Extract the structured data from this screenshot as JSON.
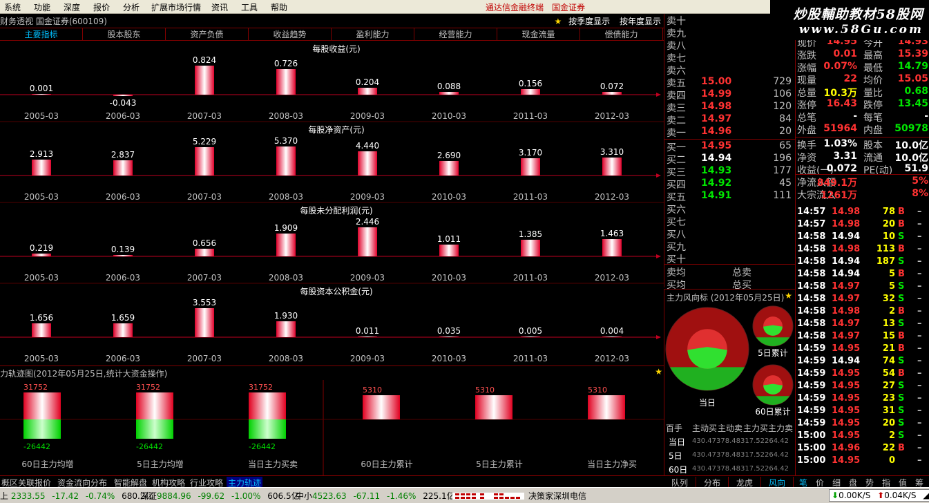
{
  "menu": {
    "items": [
      "系统",
      "功能",
      "深度",
      "报价",
      "分析",
      "扩展市场行情",
      "资讯",
      "工具",
      "帮助"
    ],
    "right_links": [
      "通达信金融终端",
      "国金证券"
    ]
  },
  "watermark": {
    "line1": "炒股輔助教材58股网",
    "line2": "www.58Gu.com"
  },
  "finance": {
    "title": "财务透视  国金证券(600109)",
    "buttons": [
      "按季度显示",
      "按年度显示"
    ],
    "tabs": [
      "主要指标",
      "股本股东",
      "资产负债",
      "收益趋势",
      "盈利能力",
      "经营能力",
      "现金流量",
      "偿债能力"
    ],
    "active_tab": 0,
    "periods": [
      "2005-03",
      "2006-03",
      "2007-03",
      "2008-03",
      "2009-03",
      "2010-03",
      "2011-03",
      "2012-03"
    ],
    "panels": [
      {
        "title": "每股收益(元)",
        "values": [
          0.001,
          -0.043,
          0.824,
          0.726,
          0.204,
          0.088,
          0.156,
          0.072
        ],
        "labels": [
          "0.001",
          "-0.043",
          "0.824",
          "0.726",
          "0.204",
          "0.088",
          "0.156",
          "0.072"
        ]
      },
      {
        "title": "每股净资产(元)",
        "values": [
          2.913,
          2.837,
          5.229,
          5.37,
          4.44,
          2.69,
          3.17,
          3.31
        ],
        "labels": [
          "2.913",
          "2.837",
          "5.229",
          "5.370",
          "4.440",
          "2.690",
          "3.170",
          "3.310"
        ]
      },
      {
        "title": "每股未分配利润(元)",
        "values": [
          0.219,
          0.139,
          0.656,
          1.909,
          2.446,
          1.011,
          1.385,
          1.463
        ],
        "labels": [
          "0.219",
          "0.139",
          "0.656",
          "1.909",
          "2.446",
          "1.011",
          "1.385",
          "1.463"
        ]
      },
      {
        "title": "每股资本公积金(元)",
        "values": [
          1.656,
          1.659,
          3.553,
          1.93,
          0.011,
          0.035,
          0.005,
          0.004
        ],
        "labels": [
          "1.656",
          "1.659",
          "3.553",
          "1.930",
          "0.011",
          "0.035",
          "0.005",
          "0.004"
        ]
      }
    ]
  },
  "main_force": {
    "title": "力轨迹图(2012年05月25日,统计大资金操作)",
    "bars": [
      {
        "label": "60日主力均增",
        "top": "31752",
        "bottom": "-26442",
        "split": true
      },
      {
        "label": "5日主力均增",
        "top": "31752",
        "bottom": "-26442",
        "split": true
      },
      {
        "label": "当日主力买卖",
        "top": "31752",
        "bottom": "-26442",
        "split": true
      },
      {
        "label": "60日主力累计",
        "top": "5310",
        "bottom": "",
        "split": false
      },
      {
        "label": "5日主力累计",
        "top": "5310",
        "bottom": "",
        "split": false
      },
      {
        "label": "当日主力净买",
        "top": "5310",
        "bottom": "",
        "split": false
      }
    ]
  },
  "order_book": {
    "sells": [
      {
        "label": "卖十",
        "price": "",
        "vol": ""
      },
      {
        "label": "卖九",
        "price": "",
        "vol": ""
      },
      {
        "label": "卖八",
        "price": "",
        "vol": ""
      },
      {
        "label": "卖七",
        "price": "",
        "vol": ""
      },
      {
        "label": "卖六",
        "price": "",
        "vol": ""
      },
      {
        "label": "卖五",
        "price": "15.00",
        "vol": "729",
        "color": "red"
      },
      {
        "label": "卖四",
        "price": "14.99",
        "vol": "106",
        "color": "red"
      },
      {
        "label": "卖三",
        "price": "14.98",
        "vol": "120",
        "color": "red"
      },
      {
        "label": "卖二",
        "price": "14.97",
        "vol": "84",
        "color": "red"
      },
      {
        "label": "卖一",
        "price": "14.96",
        "vol": "20",
        "color": "red"
      }
    ],
    "buys": [
      {
        "label": "买一",
        "price": "14.95",
        "vol": "65",
        "color": "red"
      },
      {
        "label": "买二",
        "price": "14.94",
        "vol": "196",
        "color": "wht"
      },
      {
        "label": "买三",
        "price": "14.93",
        "vol": "177",
        "color": "grn"
      },
      {
        "label": "买四",
        "price": "14.92",
        "vol": "45",
        "color": "grn"
      },
      {
        "label": "买五",
        "price": "14.91",
        "vol": "111",
        "color": "grn"
      },
      {
        "label": "买六",
        "price": "",
        "vol": ""
      },
      {
        "label": "买七",
        "price": "",
        "vol": ""
      },
      {
        "label": "买八",
        "price": "",
        "vol": ""
      },
      {
        "label": "买九",
        "price": "",
        "vol": ""
      },
      {
        "label": "买十",
        "price": "",
        "vol": ""
      }
    ],
    "avg_sell_label": "卖均",
    "avg_buy_label": "买均",
    "total_sell_label": "总卖",
    "total_buy_label": "总买"
  },
  "quote": [
    {
      "l1": "现价",
      "v1": "14.95",
      "c1": "red",
      "l2": "今开",
      "v2": "14.93",
      "c2": "red"
    },
    {
      "l1": "涨跌",
      "v1": "0.01",
      "c1": "red",
      "l2": "最高",
      "v2": "15.39",
      "c2": "red"
    },
    {
      "l1": "涨幅",
      "v1": "0.07%",
      "c1": "red",
      "l2": "最低",
      "v2": "14.79",
      "c2": "grn"
    },
    {
      "l1": "现量",
      "v1": "22",
      "c1": "red",
      "l2": "均价",
      "v2": "15.05",
      "c2": "red"
    },
    {
      "l1": "总量",
      "v1": "10.3万",
      "c1": "yel",
      "l2": "量比",
      "v2": "0.68",
      "c2": "grn"
    },
    {
      "l1": "涨停",
      "v1": "16.43",
      "c1": "red",
      "l2": "跌停",
      "v2": "13.45",
      "c2": "grn"
    },
    {
      "l1": "总笔",
      "v1": "-",
      "c1": "wht",
      "l2": "每笔",
      "v2": "-",
      "c2": "wht"
    },
    {
      "l1": "外盘",
      "v1": "51964",
      "c1": "red",
      "l2": "内盘",
      "v2": "50978",
      "c2": "grn"
    },
    {
      "l1": "换手",
      "v1": "1.03%",
      "c1": "wht",
      "l2": "股本",
      "v2": "10.0亿",
      "c2": "wht"
    },
    {
      "l1": "净资",
      "v1": "3.31",
      "c1": "wht",
      "l2": "流通",
      "v2": "10.0亿",
      "c2": "wht"
    },
    {
      "l1": "收益(一)",
      "v1": "0.072",
      "c1": "wht",
      "l2": "PE(动)",
      "v2": "51.9",
      "c2": "wht"
    },
    {
      "l1": "净流入额",
      "v1": "849.1万",
      "c1": "red",
      "l2": "",
      "v2": "5%",
      "c2": "red"
    },
    {
      "l1": "大宗流入",
      "v1": "1261万",
      "c1": "red",
      "l2": "",
      "v2": "8%",
      "c2": "red"
    }
  ],
  "ticks": [
    {
      "t": "14:57",
      "p": "14.98",
      "pc": "red",
      "v": "78",
      "f": "B"
    },
    {
      "t": "14:57",
      "p": "14.98",
      "pc": "red",
      "v": "20",
      "f": "B"
    },
    {
      "t": "14:58",
      "p": "14.94",
      "pc": "wht",
      "v": "10",
      "f": "S"
    },
    {
      "t": "14:58",
      "p": "14.98",
      "pc": "red",
      "v": "113",
      "f": "B"
    },
    {
      "t": "14:58",
      "p": "14.94",
      "pc": "wht",
      "v": "187",
      "f": "S"
    },
    {
      "t": "14:58",
      "p": "14.94",
      "pc": "wht",
      "v": "5",
      "f": "B"
    },
    {
      "t": "14:58",
      "p": "14.97",
      "pc": "red",
      "v": "5",
      "f": "S"
    },
    {
      "t": "14:58",
      "p": "14.97",
      "pc": "red",
      "v": "32",
      "f": "S"
    },
    {
      "t": "14:58",
      "p": "14.98",
      "pc": "red",
      "v": "2",
      "f": "B"
    },
    {
      "t": "14:58",
      "p": "14.97",
      "pc": "red",
      "v": "13",
      "f": "S"
    },
    {
      "t": "14:58",
      "p": "14.97",
      "pc": "red",
      "v": "15",
      "f": "B"
    },
    {
      "t": "14:59",
      "p": "14.95",
      "pc": "red",
      "v": "21",
      "f": "B"
    },
    {
      "t": "14:59",
      "p": "14.94",
      "pc": "wht",
      "v": "74",
      "f": "S"
    },
    {
      "t": "14:59",
      "p": "14.95",
      "pc": "red",
      "v": "54",
      "f": "B"
    },
    {
      "t": "14:59",
      "p": "14.95",
      "pc": "red",
      "v": "27",
      "f": "S"
    },
    {
      "t": "14:59",
      "p": "14.95",
      "pc": "red",
      "v": "23",
      "f": "S"
    },
    {
      "t": "14:59",
      "p": "14.95",
      "pc": "red",
      "v": "31",
      "f": "S"
    },
    {
      "t": "14:59",
      "p": "14.95",
      "pc": "red",
      "v": "20",
      "f": "S"
    },
    {
      "t": "15:00",
      "p": "14.95",
      "pc": "red",
      "v": "2",
      "f": "S"
    },
    {
      "t": "15:00",
      "p": "14.96",
      "pc": "red",
      "v": "22",
      "f": "B"
    },
    {
      "t": "15:00",
      "p": "14.95",
      "pc": "red",
      "v": "0",
      "f": ""
    }
  ],
  "wind": {
    "title": "主力风向标 (2012年05月25日)",
    "pie_labels": [
      "当日",
      "5日累计",
      "60日累计"
    ],
    "table_header": [
      "百手",
      "主动买",
      "主动卖",
      "主力买",
      "主力卖"
    ],
    "table_rows": [
      {
        "label": "当日",
        "vals": "430.47378.48317.52264.42"
      },
      {
        "label": "5日",
        "vals": "430.47378.48317.52264.42"
      },
      {
        "label": "60日",
        "vals": "430.47378.48317.52264.42"
      }
    ]
  },
  "right_tabs": [
    "队列",
    "分布",
    "龙虎",
    "风向"
  ],
  "right_tabs_active": 3,
  "func_tabs": [
    "笔",
    "价",
    "细",
    "盘",
    "势",
    "指",
    "值",
    "筹"
  ],
  "func_tabs_active": 0,
  "bottom_tabs": [
    {
      "label": "概区",
      "color": "#c0c0c0"
    },
    {
      "label": "关联报价",
      "color": "#c0c0c0"
    },
    {
      "label": "资金流向分布",
      "color": "#c0c0c0"
    },
    {
      "label": "智能解盘",
      "color": "#c0c0c0"
    },
    {
      "label": "机构攻略",
      "color": "#c0c0c0"
    },
    {
      "label": "行业攻略",
      "color": "#c0c0c0"
    },
    {
      "label": "主力轨迹",
      "color": "#00c0ff"
    }
  ],
  "status": {
    "sh": {
      "name": "上",
      "val": "2333.55",
      "chg": "-17.42",
      "pct": "-0.74%",
      "amt": "680.2亿"
    },
    "sz": {
      "name": "深证",
      "val": "9884.96",
      "chg": "-99.62",
      "pct": "-1.00%",
      "amt": "606.5亿"
    },
    "zx": {
      "name": "中小",
      "val": "4523.63",
      "chg": "-67.11",
      "pct": "-1.46%",
      "amt": "225.1亿"
    },
    "server": "决策家深圳电信",
    "net_down": "0.00K/S",
    "net_up": "0.04K/S"
  }
}
